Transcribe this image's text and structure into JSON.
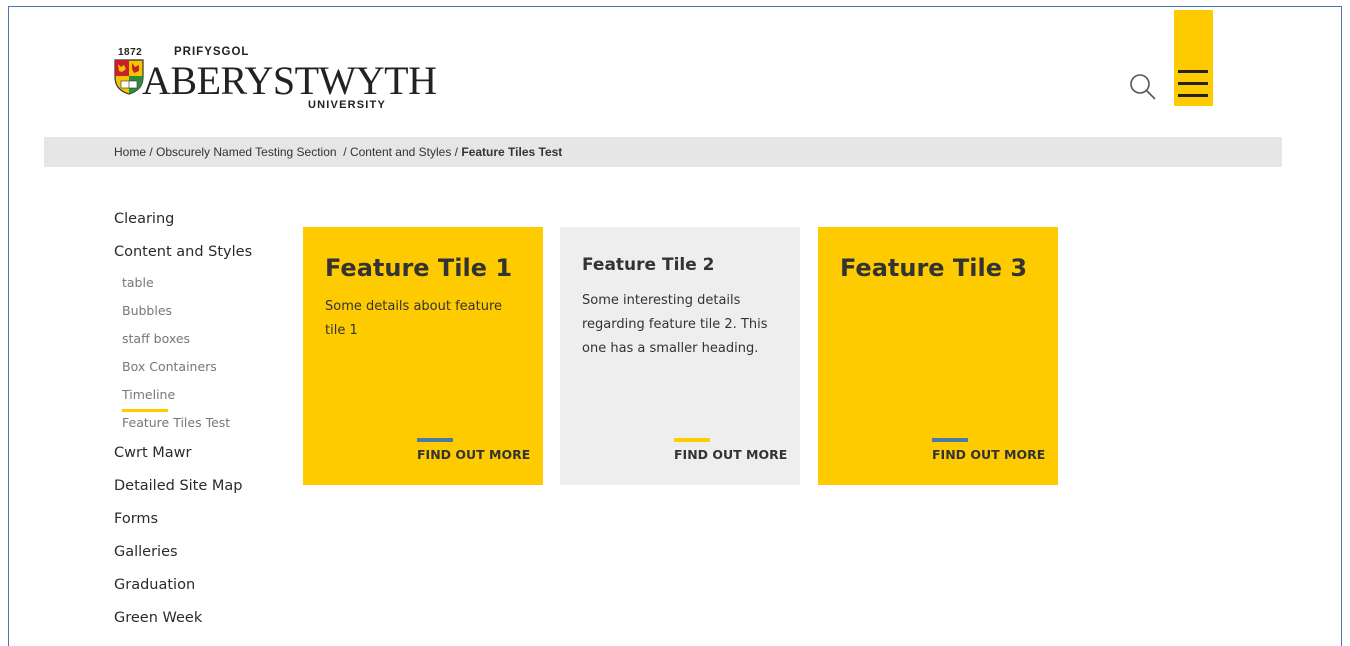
{
  "logo": {
    "year": "1872",
    "top_text": "PRIFYSGOL",
    "name": "ABERYSTWYTH",
    "bottom_text": "UNIVERSITY"
  },
  "icons": {
    "search": "search-icon",
    "menu": "hamburger-menu-icon"
  },
  "colors": {
    "accent_yellow": "#fecb00",
    "accent_blue": "#4a7ba6",
    "breadcrumb_bg": "#e6e6e6",
    "tile_grey": "#eeeeee"
  },
  "breadcrumb": {
    "items": [
      "Home",
      "Obscurely Named Testing Section",
      "Content and Styles"
    ],
    "separator": " / ",
    "current": "Feature Tiles Test"
  },
  "sidebar": {
    "items": [
      "Clearing",
      "Content and Styles",
      "Cwrt Mawr",
      "Detailed Site Map",
      "Forms",
      "Galleries",
      "Graduation",
      "Green Week"
    ],
    "sub_items": [
      "table",
      "Bubbles",
      "staff boxes",
      "Box Containers",
      "Timeline",
      "Feature Tiles Test"
    ]
  },
  "tiles": [
    {
      "title": "Feature Tile 1",
      "text": "Some details about feature tile 1",
      "link": "FIND OUT MORE"
    },
    {
      "title": "Feature Tile 2",
      "text": "Some interesting details regarding feature tile 2. This one has a smaller heading.",
      "link": "FIND OUT MORE"
    },
    {
      "title": "Feature Tile 3",
      "text": "",
      "link": "FIND OUT MORE"
    }
  ]
}
